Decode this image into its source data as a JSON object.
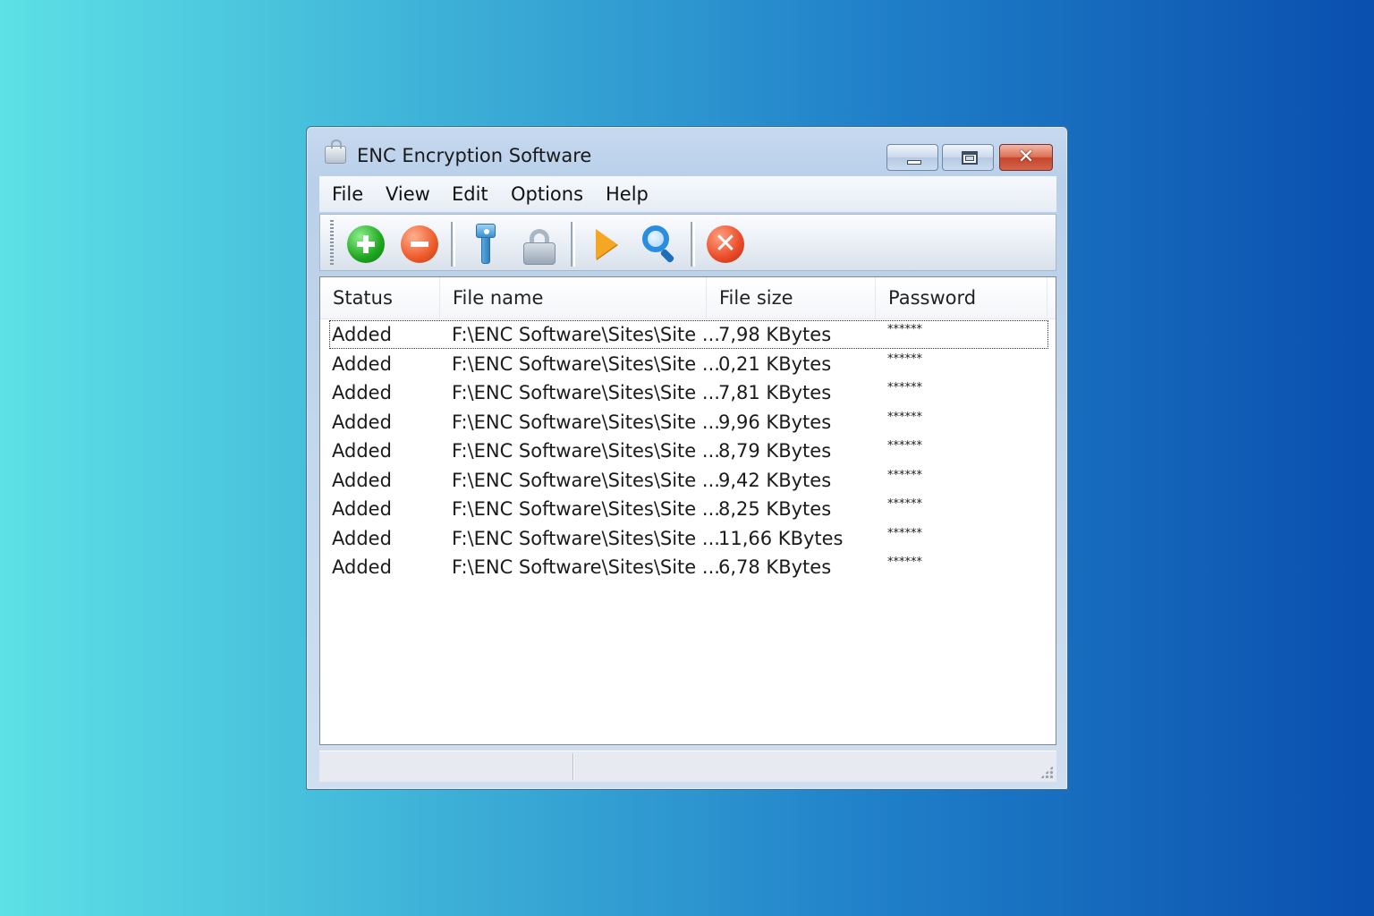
{
  "window": {
    "title": "ENC Encryption Software",
    "close_glyph": "✕"
  },
  "menu": [
    "File",
    "View",
    "Edit",
    "Options",
    "Help"
  ],
  "toolbar": {
    "icons": [
      "add-icon",
      "remove-icon",
      "key-icon",
      "lock-icon",
      "play-icon",
      "search-icon",
      "cancel-icon"
    ]
  },
  "table": {
    "columns": [
      "Status",
      "File name",
      "File size",
      "Password"
    ],
    "rows": [
      {
        "status": "Added",
        "file": "F:\\ENC Software\\Sites\\Site ...",
        "size": "7,98 KBytes",
        "password": "******"
      },
      {
        "status": "Added",
        "file": "F:\\ENC Software\\Sites\\Site ...",
        "size": "0,21 KBytes",
        "password": "******"
      },
      {
        "status": "Added",
        "file": "F:\\ENC Software\\Sites\\Site ...",
        "size": "7,81 KBytes",
        "password": "******"
      },
      {
        "status": "Added",
        "file": "F:\\ENC Software\\Sites\\Site ...",
        "size": "9,96 KBytes",
        "password": "******"
      },
      {
        "status": "Added",
        "file": "F:\\ENC Software\\Sites\\Site ...",
        "size": "8,79 KBytes",
        "password": "******"
      },
      {
        "status": "Added",
        "file": "F:\\ENC Software\\Sites\\Site ...",
        "size": "9,42 KBytes",
        "password": "******"
      },
      {
        "status": "Added",
        "file": "F:\\ENC Software\\Sites\\Site ...",
        "size": "8,25 KBytes",
        "password": "******"
      },
      {
        "status": "Added",
        "file": "F:\\ENC Software\\Sites\\Site ...",
        "size": "11,66 KBytes",
        "password": "******"
      },
      {
        "status": "Added",
        "file": "F:\\ENC Software\\Sites\\Site ...",
        "size": "6,78 KBytes",
        "password": "******"
      }
    ]
  },
  "colors": {
    "background_left": "#5de0e6",
    "background_right": "#0a4fae",
    "window_frame": "#c6d9ef",
    "close_button": "#c6452c"
  }
}
